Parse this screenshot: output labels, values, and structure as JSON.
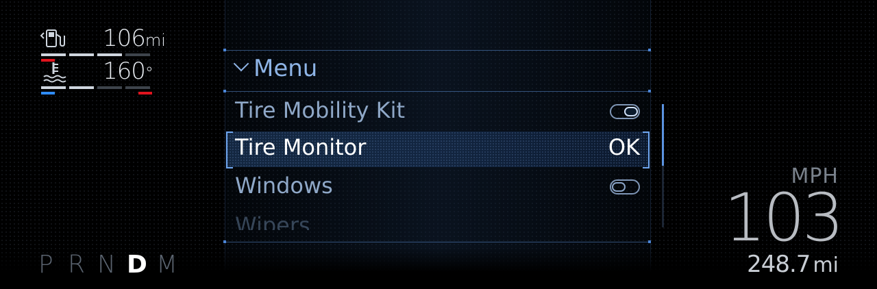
{
  "fuel": {
    "value": "106",
    "unit": "mi",
    "icon": "fuel-pump-icon"
  },
  "temp": {
    "value": "160",
    "unit": "°",
    "icon": "coolant-temperature-icon"
  },
  "menu": {
    "title": "Menu",
    "items": [
      {
        "label": "Tire Mobility Kit",
        "control": "toggle",
        "state": "on"
      },
      {
        "label": "Tire Monitor",
        "control": "value",
        "value": "OK",
        "selected": true
      },
      {
        "label": "Windows",
        "control": "toggle",
        "state": "off"
      },
      {
        "label": "Wipers"
      }
    ]
  },
  "gear": {
    "options": [
      "P",
      "R",
      "N",
      "D",
      "M"
    ],
    "active": "D"
  },
  "speed": {
    "unit": "MPH",
    "value": "103"
  },
  "range": {
    "value": "248.7",
    "unit": "mi"
  },
  "colors": {
    "accent": "#5b93e0",
    "warning": "#e0141e",
    "cold": "#2f8cff"
  }
}
